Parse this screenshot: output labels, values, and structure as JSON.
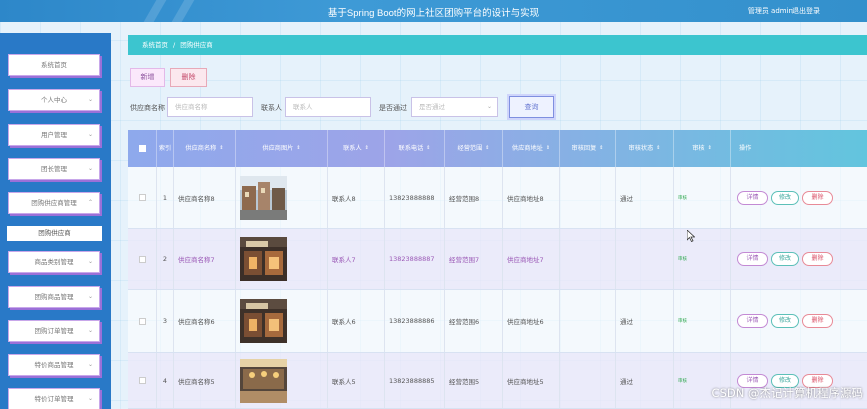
{
  "header": {
    "title": "基于Spring Boot的网上社区团购平台的设计与实现",
    "user": "管理员 admin",
    "logout": "退出登录"
  },
  "sidebar": {
    "items": [
      {
        "label": "系统首页",
        "icon": ""
      },
      {
        "label": "个人中心",
        "icon": "chevron-down-icon"
      },
      {
        "label": "用户管理",
        "icon": "chevron-down-icon"
      },
      {
        "label": "团长管理",
        "icon": "chevron-down-icon"
      },
      {
        "label": "团购供应商管理",
        "icon": "chevron-up-icon"
      },
      {
        "label": "商品类别管理",
        "icon": "chevron-down-icon"
      },
      {
        "label": "团购商品管理",
        "icon": "chevron-down-icon"
      },
      {
        "label": "团购订单管理",
        "icon": "chevron-down-icon"
      },
      {
        "label": "特价商品管理",
        "icon": "chevron-down-icon"
      },
      {
        "label": "特价订单管理",
        "icon": "chevron-down-icon"
      }
    ],
    "subitem": "团购供应商",
    "chevron_down": "⌄",
    "chevron_up": "⌃"
  },
  "breadcrumb": {
    "home": "系统首页",
    "separator": "/",
    "current": "团购供应商"
  },
  "actions": {
    "add": "新增",
    "delete": "删除"
  },
  "search": {
    "name_label": "供应商名称",
    "name_placeholder": "供应商名称",
    "contact_label": "联系人",
    "contact_placeholder": "联系人",
    "approved_label": "是否通过",
    "approved_placeholder": "是否通过",
    "button": "查询"
  },
  "table": {
    "columns": [
      "索引",
      "供应商名称",
      "供应商图片",
      "联系人",
      "联系电话",
      "经营范围",
      "供应商地址",
      "审核回复",
      "审核状态",
      "审核",
      "操作"
    ],
    "sort_icon": "⇕",
    "rows": [
      {
        "index": "1",
        "name": "供应商名称8",
        "photo": "street-scene",
        "contact": "联系人8",
        "phone": "13823888888",
        "scope": "经营范围8",
        "address": "供应商地址8",
        "reply": "",
        "status": "通过",
        "review": "审核",
        "ops": [
          "详情",
          "修改",
          "删除"
        ]
      },
      {
        "index": "2",
        "name": "供应商名称7",
        "photo": "shop-front",
        "contact": "联系人7",
        "phone": "13823888887",
        "scope": "经营范围7",
        "address": "供应商地址7",
        "reply": "",
        "status": "",
        "review": "审核",
        "ops": [
          "详情",
          "修改",
          "删除"
        ]
      },
      {
        "index": "3",
        "name": "供应商名称6",
        "photo": "shop-front",
        "contact": "联系人6",
        "phone": "13823888886",
        "scope": "经营范围6",
        "address": "供应商地址6",
        "reply": "",
        "status": "通过",
        "review": "审核",
        "ops": [
          "详情",
          "修改",
          "删除"
        ]
      },
      {
        "index": "4",
        "name": "供应商名称5",
        "photo": "restaurant-interior",
        "contact": "联系人5",
        "phone": "13823888885",
        "scope": "经营范围5",
        "address": "供应商地址5",
        "reply": "",
        "status": "通过",
        "review": "审核",
        "ops": [
          "详情",
          "修改",
          "删除"
        ]
      }
    ]
  },
  "watermark": "CSDN @杰记计算机程序源码",
  "colors": {
    "header": "#2d87c9",
    "sidebar": "#2979c7",
    "breadcrumb": "#3cc5cf",
    "accent_purple": "#9b59b6"
  }
}
